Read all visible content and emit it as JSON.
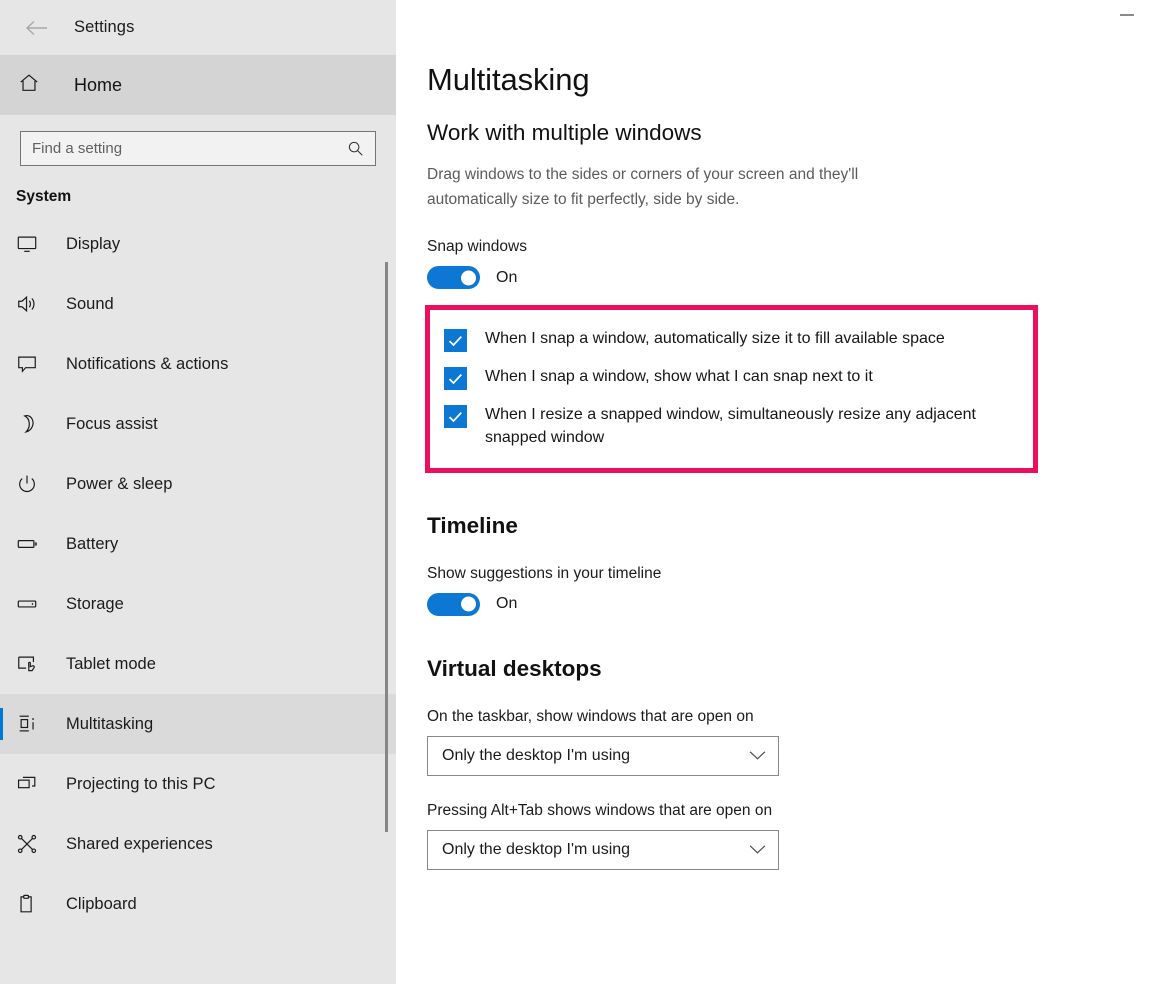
{
  "window": {
    "app_title": "Settings",
    "back_icon": "back-arrow-icon",
    "minimize_label": "Minimize"
  },
  "sidebar": {
    "home": {
      "label": "Home",
      "icon": "home-icon"
    },
    "search": {
      "placeholder": "Find a setting",
      "value": "",
      "icon": "search-icon"
    },
    "group_title": "System",
    "items": [
      {
        "label": "Display",
        "icon": "monitor-icon",
        "selected": false
      },
      {
        "label": "Sound",
        "icon": "speaker-icon",
        "selected": false
      },
      {
        "label": "Notifications & actions",
        "icon": "chat-bubble-icon",
        "selected": false
      },
      {
        "label": "Focus assist",
        "icon": "moon-icon",
        "selected": false
      },
      {
        "label": "Power & sleep",
        "icon": "power-icon",
        "selected": false
      },
      {
        "label": "Battery",
        "icon": "battery-icon",
        "selected": false
      },
      {
        "label": "Storage",
        "icon": "drive-icon",
        "selected": false
      },
      {
        "label": "Tablet mode",
        "icon": "tablet-touch-icon",
        "selected": false
      },
      {
        "label": "Multitasking",
        "icon": "multitasking-icon",
        "selected": true
      },
      {
        "label": "Projecting to this PC",
        "icon": "project-screen-icon",
        "selected": false
      },
      {
        "label": "Shared experiences",
        "icon": "share-nodes-icon",
        "selected": false
      },
      {
        "label": "Clipboard",
        "icon": "clipboard-icon",
        "selected": false
      }
    ]
  },
  "main": {
    "page_title": "Multitasking",
    "snap": {
      "section_heading": "Work with multiple windows",
      "description": "Drag windows to the sides or corners of your screen and they'll automatically size to fit perfectly, side by side.",
      "toggle_label": "Snap windows",
      "toggle_state": "On",
      "options": [
        "When I snap a window, automatically size it to fill available space",
        "When I snap a window, show what I can snap next to it",
        "When I resize a snapped window, simultaneously resize any adjacent snapped window"
      ]
    },
    "timeline": {
      "heading": "Timeline",
      "toggle_label": "Show suggestions in your timeline",
      "toggle_state": "On"
    },
    "virtual_desktops": {
      "heading": "Virtual desktops",
      "taskbar_label": "On the taskbar, show windows that are open on",
      "taskbar_value": "Only the desktop I'm using",
      "alttab_label": "Pressing Alt+Tab shows windows that are open on",
      "alttab_value": "Only the desktop I'm using"
    }
  },
  "colors": {
    "accent_blue": "#0c78d4",
    "highlight_red": "#eb0f5e",
    "sidebar_bg": "#e6e6e6",
    "selected_row": "#dadada"
  }
}
